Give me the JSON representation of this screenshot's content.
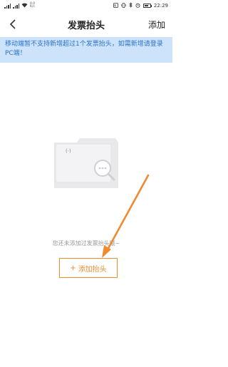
{
  "status_bar": {
    "net_speed_top": "0.0",
    "net_speed_bottom": "K/s",
    "time": "22:29",
    "battery_level": 0.7
  },
  "nav": {
    "title": "发票抬头",
    "add_label": "添加"
  },
  "notice": {
    "text": "移动端暂不支持新增超过1个发票抬头，如需新增请登录PC端！"
  },
  "empty_state": {
    "message": "您还未添加过发票抬头哦~",
    "button_plus": "+",
    "button_label": "添加抬头"
  },
  "colors": {
    "accent": "#f08a2f",
    "notice_bg": "#cde3fb",
    "notice_text": "#2a73c8"
  }
}
